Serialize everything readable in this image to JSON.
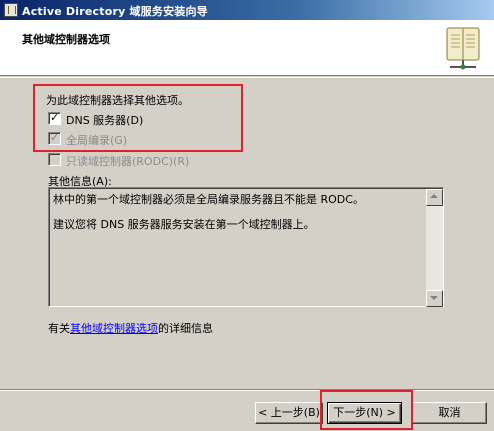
{
  "window": {
    "title": "Active Directory 域服务安装向导"
  },
  "header": {
    "title": "其他域控制器选项",
    "icon": "book-network-icon"
  },
  "options": {
    "instruction": "为此域控制器选择其他选项。",
    "dns": {
      "label": "DNS 服务器(D)",
      "checked": true,
      "enabled": true
    },
    "global_catalog": {
      "label": "全局编录(G)",
      "checked": true,
      "enabled": false
    },
    "rodc": {
      "label": "只读域控制器(RODC)(R)",
      "checked": false,
      "enabled": false
    }
  },
  "info": {
    "label": "其他信息(A):",
    "lines": [
      "林中的第一个域控制器必须是全局编录服务器且不能是 RODC。",
      "建议您将 DNS 服务器服务安装在第一个域控制器上。"
    ]
  },
  "more_info": {
    "prefix": "有关",
    "link": "其他域控制器选项",
    "suffix": "的详细信息"
  },
  "buttons": {
    "back": "< 上一步(B)",
    "next": "下一步(N) >",
    "cancel": "取消"
  },
  "highlight_color": "#e0202a"
}
